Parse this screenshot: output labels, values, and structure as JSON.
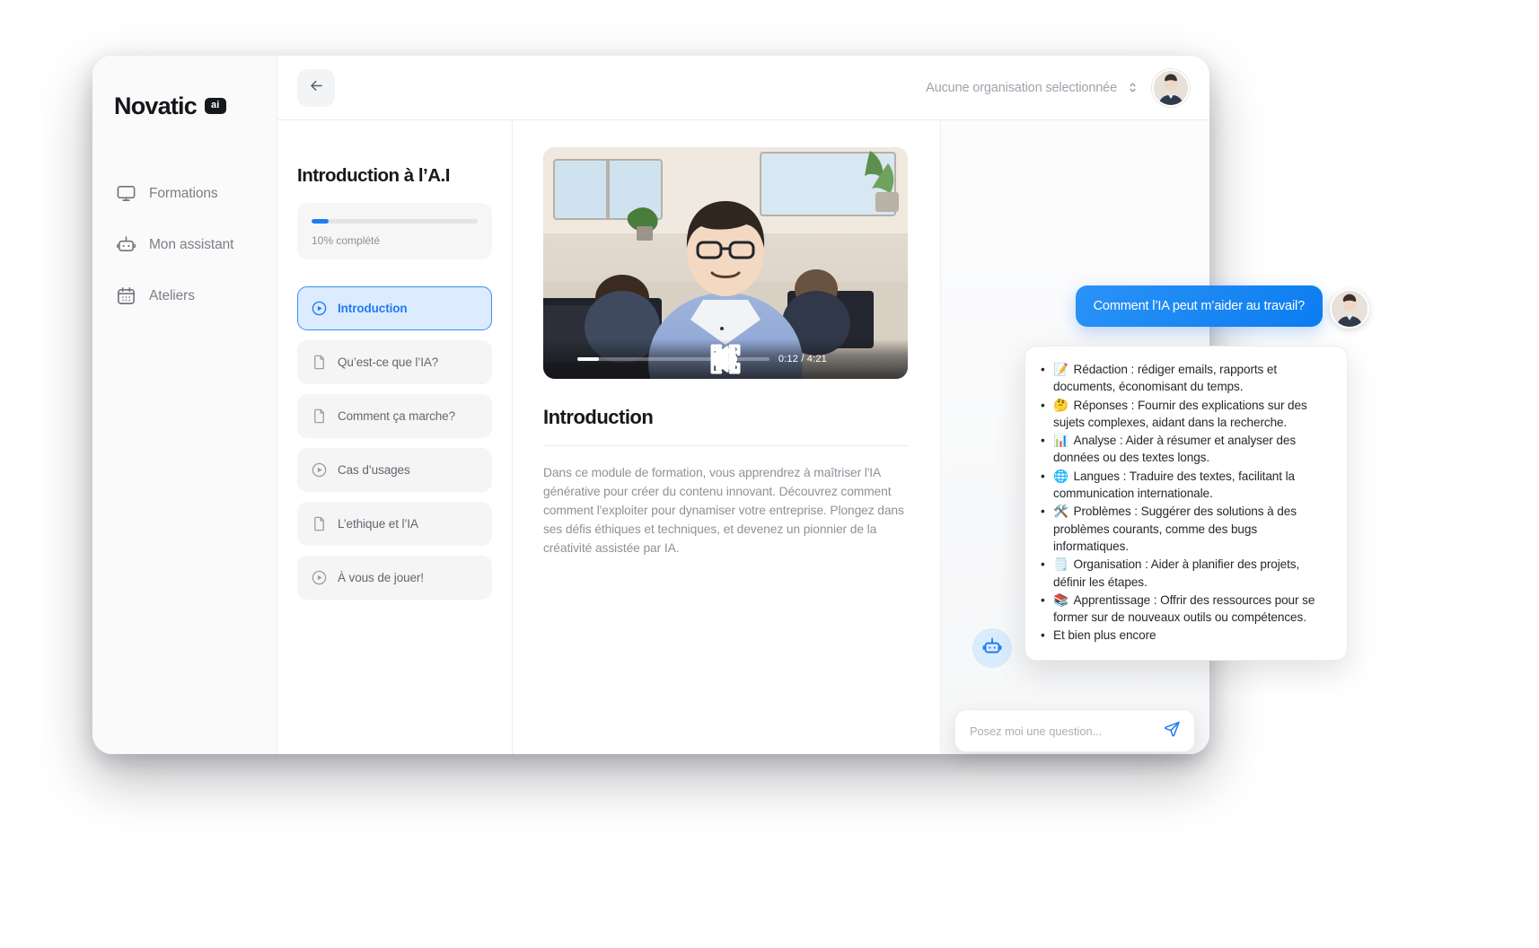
{
  "brand": {
    "name": "Novatic",
    "badge": "ai"
  },
  "sidebar": {
    "items": [
      {
        "label": "Formations",
        "icon": "monitor-icon"
      },
      {
        "label": "Mon assistant",
        "icon": "robot-icon"
      },
      {
        "label": "Ateliers",
        "icon": "calendar-icon"
      }
    ]
  },
  "topbar": {
    "back_icon": "arrow-left-icon",
    "org_label": "Aucune organisation selectionnée",
    "chevron_icon": "chevron-updown-icon",
    "avatar_icon": "user-avatar"
  },
  "course": {
    "title": "Introduction à l’A.I",
    "progress_percent": 10,
    "progress_label": "10% complété",
    "lessons": [
      {
        "label": "Introduction",
        "icon": "play-circle-icon",
        "active": true
      },
      {
        "label": "Qu’est-ce que l’IA?",
        "icon": "document-icon",
        "active": false
      },
      {
        "label": "Comment ça marche?",
        "icon": "document-icon",
        "active": false
      },
      {
        "label": "Cas d’usages",
        "icon": "play-circle-icon",
        "active": false
      },
      {
        "label": "L’ethique et l’IA",
        "icon": "document-icon",
        "active": false
      },
      {
        "label": "À vous de jouer!",
        "icon": "play-circle-icon",
        "active": false
      }
    ]
  },
  "player": {
    "pause_icon": "pause-icon",
    "time": "0:12 / 4:21",
    "progress_percent": 11,
    "volume_icon": "volume-icon",
    "settings_icon": "pip-icon",
    "fullscreen_icon": "fullscreen-icon"
  },
  "article": {
    "heading": "Introduction",
    "body": "Dans ce module de formation, vous apprendrez à maîtriser l'IA générative pour créer du contenu innovant. Découvrez comment comment l'exploiter pour dynamiser votre entreprise. Plongez dans ses défis éthiques et techniques, et devenez un pionnier de la créativité assistée par IA."
  },
  "chat": {
    "user_message": "Comment  l’IA peut m’aider au travail?",
    "bot_avatar_icon": "robot-icon",
    "bot_bullets": [
      {
        "emoji": "📝",
        "text": "Rédaction : rédiger emails, rapports et documents, économisant du temps."
      },
      {
        "emoji": "🤔",
        "text": "Réponses : Fournir des explications sur des sujets complexes, aidant dans la recherche."
      },
      {
        "emoji": "📊",
        "text": "Analyse : Aider à résumer et analyser des données ou des textes longs."
      },
      {
        "emoji": "🌐",
        "text": "Langues : Traduire des textes, facilitant la communication internationale."
      },
      {
        "emoji": "🛠️",
        "text": "Problèmes : Suggérer des solutions à des problèmes courants, comme des bugs informatiques."
      },
      {
        "emoji": "🗒️",
        "text": "Organisation : Aider à planifier des projets, définir les étapes."
      },
      {
        "emoji": "📚",
        "text": "Apprentissage : Offrir des ressources pour se former sur de nouveaux outils ou compétences."
      },
      {
        "emoji": "",
        "text": "Et bien plus encore"
      }
    ],
    "input_placeholder": "Posez moi une question...",
    "input_value": "",
    "send_icon": "send-icon"
  },
  "colors": {
    "accent": "#1f7bf4",
    "accent_soft": "#dcebfe",
    "text_dark": "#16181c",
    "text_muted": "#8d9299"
  }
}
